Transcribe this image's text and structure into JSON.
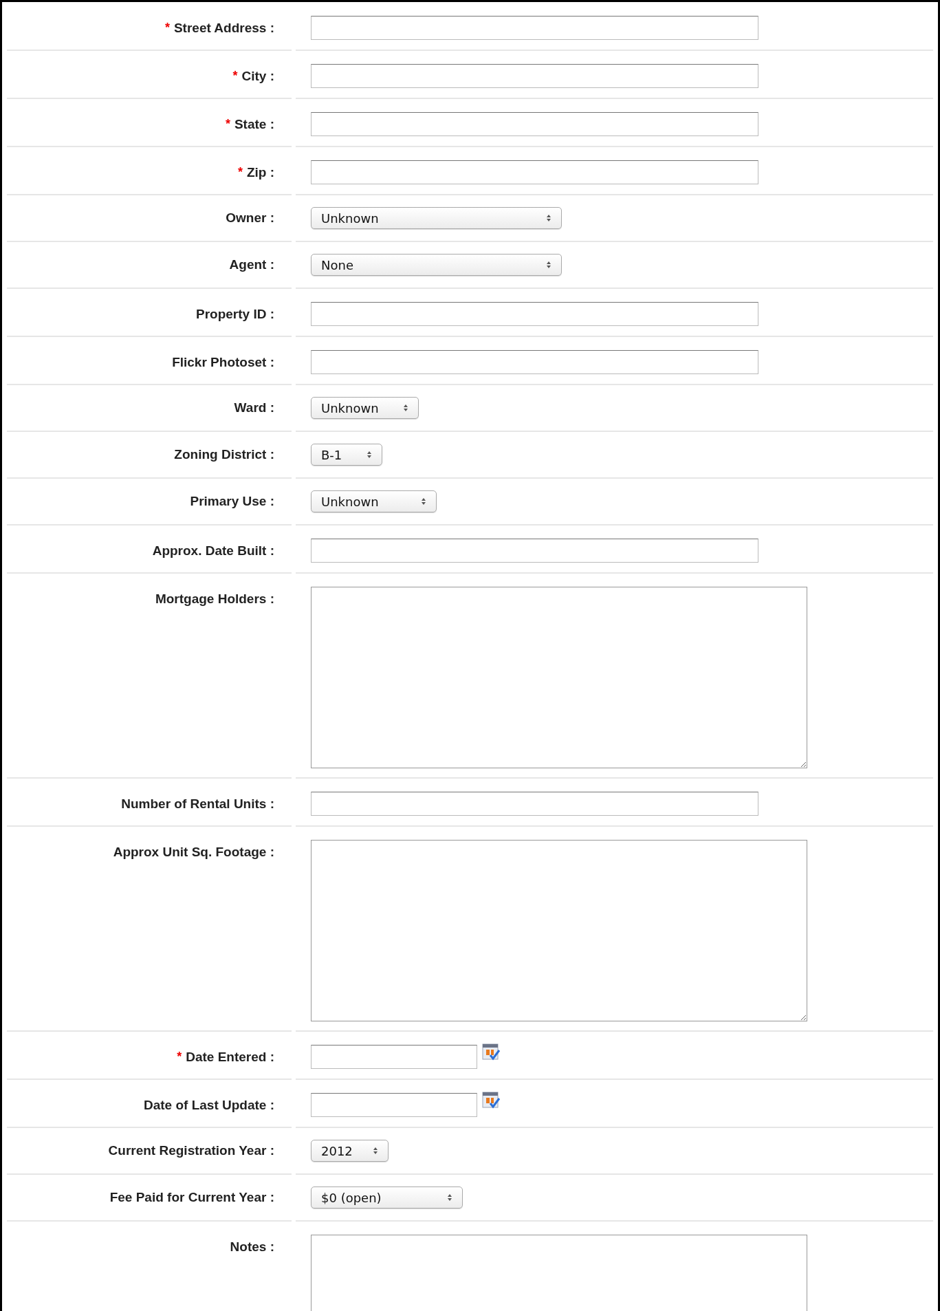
{
  "fields": [
    {
      "kind": "text",
      "label": "Street Address :",
      "marker": "*"
    },
    {
      "kind": "text",
      "label": "City :",
      "marker": "*"
    },
    {
      "kind": "text",
      "label": "State :",
      "marker": "*"
    },
    {
      "kind": "text",
      "label": "Zip :",
      "marker": "*"
    },
    {
      "kind": "select",
      "label": "Owner :",
      "value": "Unknown"
    },
    {
      "kind": "select",
      "label": "Agent :",
      "value": "None"
    },
    {
      "kind": "text",
      "label": "Property ID :"
    },
    {
      "kind": "text",
      "label": "Flickr Photoset :"
    },
    {
      "kind": "select",
      "label": "Ward :",
      "value": "Unknown"
    },
    {
      "kind": "select",
      "label": "Zoning District :",
      "value": "B-1"
    },
    {
      "kind": "select",
      "label": "Primary Use :",
      "value": "Unknown"
    },
    {
      "kind": "text",
      "label": "Approx. Date Built :"
    },
    {
      "kind": "textarea",
      "label": "Mortgage Holders :"
    },
    {
      "kind": "text",
      "label": "Number of Rental Units :"
    },
    {
      "kind": "textarea",
      "label": "Approx Unit Sq. Footage :"
    },
    {
      "kind": "date",
      "label": "Date Entered :",
      "marker": "*"
    },
    {
      "kind": "date",
      "label": "Date of Last Update :"
    },
    {
      "kind": "select",
      "label": "Current Registration Year :",
      "value": "2012"
    },
    {
      "kind": "select",
      "label": "Fee Paid for Current Year :",
      "value": "$0 (open)"
    },
    {
      "kind": "textarea",
      "label": "Notes :"
    }
  ]
}
